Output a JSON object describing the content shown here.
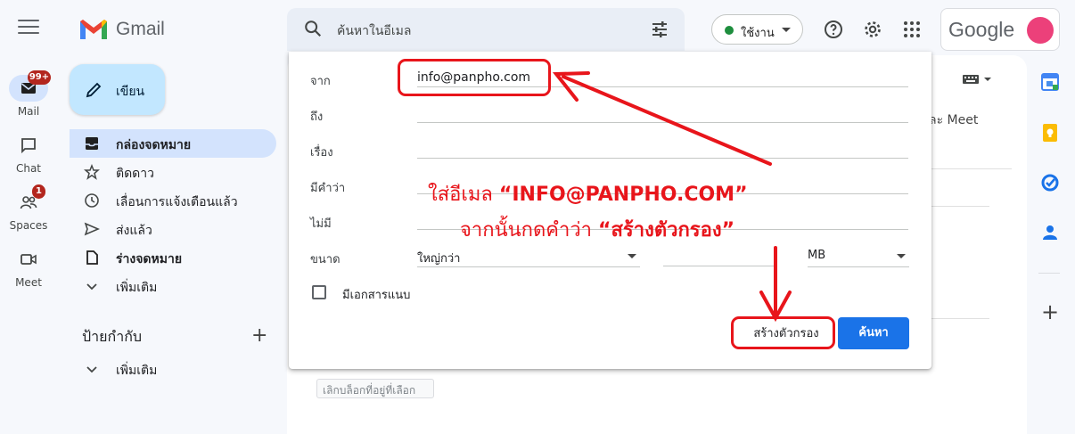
{
  "app": {
    "brand": "Gmail",
    "account_brand": "Google"
  },
  "search": {
    "placeholder": "ค้นหาในอีเมล"
  },
  "status": {
    "label": "ใช้งาน"
  },
  "rail": [
    {
      "label": "Mail",
      "badge": "99+"
    },
    {
      "label": "Chat",
      "badge": ""
    },
    {
      "label": "Spaces",
      "badge": "1"
    },
    {
      "label": "Meet",
      "badge": ""
    }
  ],
  "compose": {
    "label": "เขียน"
  },
  "nav": [
    {
      "label": "กล่องจดหมาย",
      "icon": "inbox-icon"
    },
    {
      "label": "ติดดาว",
      "icon": "star-icon"
    },
    {
      "label": "เลื่อนการแจ้งเตือนแล้ว",
      "icon": "clock-icon"
    },
    {
      "label": "ส่งแล้ว",
      "icon": "send-icon"
    },
    {
      "label": "ร่างจดหมาย",
      "icon": "draft-icon"
    },
    {
      "label": "เพิ่มเติม",
      "icon": "chevron-down-icon"
    }
  ],
  "labels_section": {
    "title": "ป้ายกำกับ",
    "more": "เพิ่มเติม"
  },
  "background": {
    "meet_text": "ละ Meet",
    "unblock_button": "เลิกบล็อกที่อยู่ที่เลือก"
  },
  "dialog": {
    "from_label": "จาก",
    "from_value": "info@panpho.com",
    "to_label": "ถึง",
    "subject_label": "เรื่อง",
    "has_words_label": "มีคำว่า",
    "doesnt_have_label": "ไม่มี",
    "size_label": "ขนาด",
    "size_compare": "ใหญ่กว่า",
    "size_unit": "MB",
    "attachment_label": "มีเอกสารแนบ",
    "create_filter_button": "สร้างตัวกรอง",
    "search_button": "ค้นหา"
  },
  "annotation": {
    "line1_prefix": "ใส่อีเมล ",
    "line1_highlight": "“INFO@PANPHO.COM”",
    "line2_prefix": "จากนั้นกดคำว่า ",
    "line2_highlight": "“สร้างตัวกรอง”",
    "color": "#e8151b"
  },
  "colors": {
    "accent": "#1a73e8",
    "active_nav": "#d3e3fd",
    "compose": "#c2e7ff"
  }
}
